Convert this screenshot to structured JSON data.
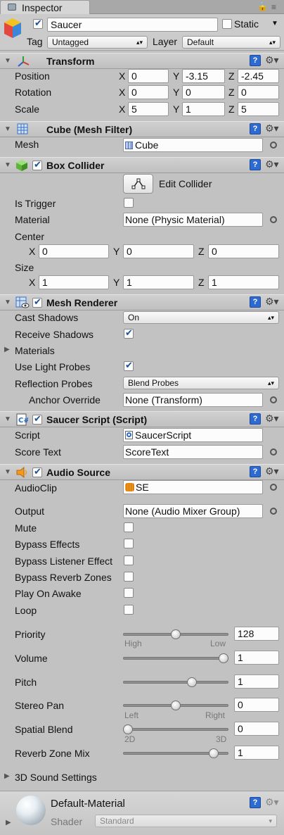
{
  "tab": {
    "title": "Inspector",
    "lock_icon": "lock-icon",
    "menu_icon": "menu-icon"
  },
  "object": {
    "active": true,
    "name": "Saucer",
    "static_label": "Static",
    "static": false,
    "tag_label": "Tag",
    "tag_value": "Untagged",
    "layer_label": "Layer",
    "layer_value": "Default"
  },
  "transform": {
    "title": "Transform",
    "position_label": "Position",
    "rotation_label": "Rotation",
    "scale_label": "Scale",
    "axis_x": "X",
    "axis_y": "Y",
    "axis_z": "Z",
    "position": {
      "x": "0",
      "y": "-3.15",
      "z": "-2.45"
    },
    "rotation": {
      "x": "0",
      "y": "0",
      "z": "0"
    },
    "scale": {
      "x": "5",
      "y": "1",
      "z": "5"
    }
  },
  "mesh_filter": {
    "title": "Cube (Mesh Filter)",
    "mesh_label": "Mesh",
    "mesh_value": "Cube"
  },
  "box_collider": {
    "title": "Box Collider",
    "enabled": true,
    "edit_label": "Edit Collider",
    "is_trigger_label": "Is Trigger",
    "is_trigger": false,
    "material_label": "Material",
    "material_value": "None (Physic Material)",
    "center_label": "Center",
    "center": {
      "x": "0",
      "y": "0",
      "z": "0"
    },
    "size_label": "Size",
    "size": {
      "x": "1",
      "y": "1",
      "z": "1"
    }
  },
  "mesh_renderer": {
    "title": "Mesh Renderer",
    "enabled": true,
    "cast_shadows_label": "Cast Shadows",
    "cast_shadows_value": "On",
    "receive_shadows_label": "Receive Shadows",
    "receive_shadows": true,
    "materials_label": "Materials",
    "use_light_probes_label": "Use Light Probes",
    "use_light_probes": true,
    "reflection_probes_label": "Reflection Probes",
    "reflection_probes_value": "Blend Probes",
    "anchor_override_label": "Anchor Override",
    "anchor_override_value": "None (Transform)"
  },
  "saucer_script": {
    "title": "Saucer Script (Script)",
    "enabled": true,
    "script_label": "Script",
    "script_value": "SaucerScript",
    "score_text_label": "Score Text",
    "score_text_value": "ScoreText"
  },
  "audio_source": {
    "title": "Audio Source",
    "enabled": true,
    "audioclip_label": "AudioClip",
    "audioclip_value": "SE",
    "output_label": "Output",
    "output_value": "None (Audio Mixer Group)",
    "mute_label": "Mute",
    "bypass_effects_label": "Bypass Effects",
    "bypass_listener_label": "Bypass Listener Effect",
    "bypass_reverb_label": "Bypass Reverb Zones",
    "play_on_awake_label": "Play On Awake",
    "loop_label": "Loop",
    "mute": false,
    "bypass_effects": false,
    "bypass_listener": false,
    "bypass_reverb": false,
    "play_on_awake": false,
    "loop": false,
    "priority_label": "Priority",
    "priority_value": "128",
    "priority_fraction": 0.5,
    "priority_low_text": "High",
    "priority_high_text": "Low",
    "volume_label": "Volume",
    "volume_value": "1",
    "volume_fraction": 1.0,
    "pitch_label": "Pitch",
    "pitch_value": "1",
    "pitch_fraction": 0.67,
    "stereo_pan_label": "Stereo Pan",
    "stereo_pan_value": "0",
    "stereo_pan_fraction": 0.5,
    "stereo_left_text": "Left",
    "stereo_right_text": "Right",
    "spatial_blend_label": "Spatial Blend",
    "spatial_blend_value": "0",
    "spatial_blend_fraction": 0.0,
    "spatial_left_text": "2D",
    "spatial_right_text": "3D",
    "reverb_mix_label": "Reverb Zone Mix",
    "reverb_mix_value": "1",
    "reverb_mix_fraction": 0.9,
    "sound_settings_label": "3D Sound Settings"
  },
  "material": {
    "name": "Default-Material",
    "shader_label": "Shader",
    "shader_value": "Standard"
  }
}
